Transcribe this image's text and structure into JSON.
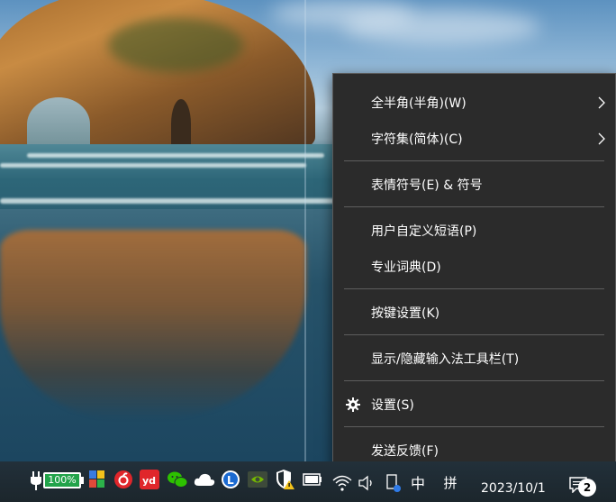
{
  "context_menu": {
    "items": [
      {
        "label": "全半角(半角)(W)",
        "has_submenu": true,
        "icon": null
      },
      {
        "label": "字符集(简体)(C)",
        "has_submenu": true,
        "icon": null
      },
      {
        "label": "表情符号(E) & 符号",
        "has_submenu": false,
        "icon": null
      },
      {
        "label": "用户自定义短语(P)",
        "has_submenu": false,
        "icon": null
      },
      {
        "label": "专业词典(D)",
        "has_submenu": false,
        "icon": null
      },
      {
        "label": "按键设置(K)",
        "has_submenu": false,
        "icon": null
      },
      {
        "label": "显示/隐藏输入法工具栏(T)",
        "has_submenu": false,
        "icon": null
      },
      {
        "label": "设置(S)",
        "has_submenu": false,
        "icon": "gear-icon"
      },
      {
        "label": "发送反馈(F)",
        "has_submenu": false,
        "icon": null
      }
    ]
  },
  "taskbar": {
    "battery": {
      "percent_label": "100%",
      "level": 1.0,
      "color": "#22a34a"
    },
    "tray_icons": [
      "power-plug-icon",
      "battery-icon",
      "colorful-app-icon",
      "netease-music-icon",
      "youdao-dict-icon",
      "wechat-icon",
      "cloud-icon",
      "lenovo-l-icon",
      "nvidia-icon",
      "security-shield-icon",
      "battery-status-icon",
      "wifi-icon",
      "volume-icon",
      "device-icon",
      "ime-mode-icon",
      "ime-layout-icon",
      "notification-icon"
    ],
    "ime_mode_label": "中",
    "ime_layout_label": "拼",
    "date": "2023/10/1",
    "notification_count": "2"
  },
  "colors": {
    "menu_bg": "#2b2b2b",
    "menu_border": "#5a5a5a",
    "separator": "#5e5e5e",
    "menu_text": "#ffffff",
    "taskbar_bg": "#1f2a30"
  }
}
